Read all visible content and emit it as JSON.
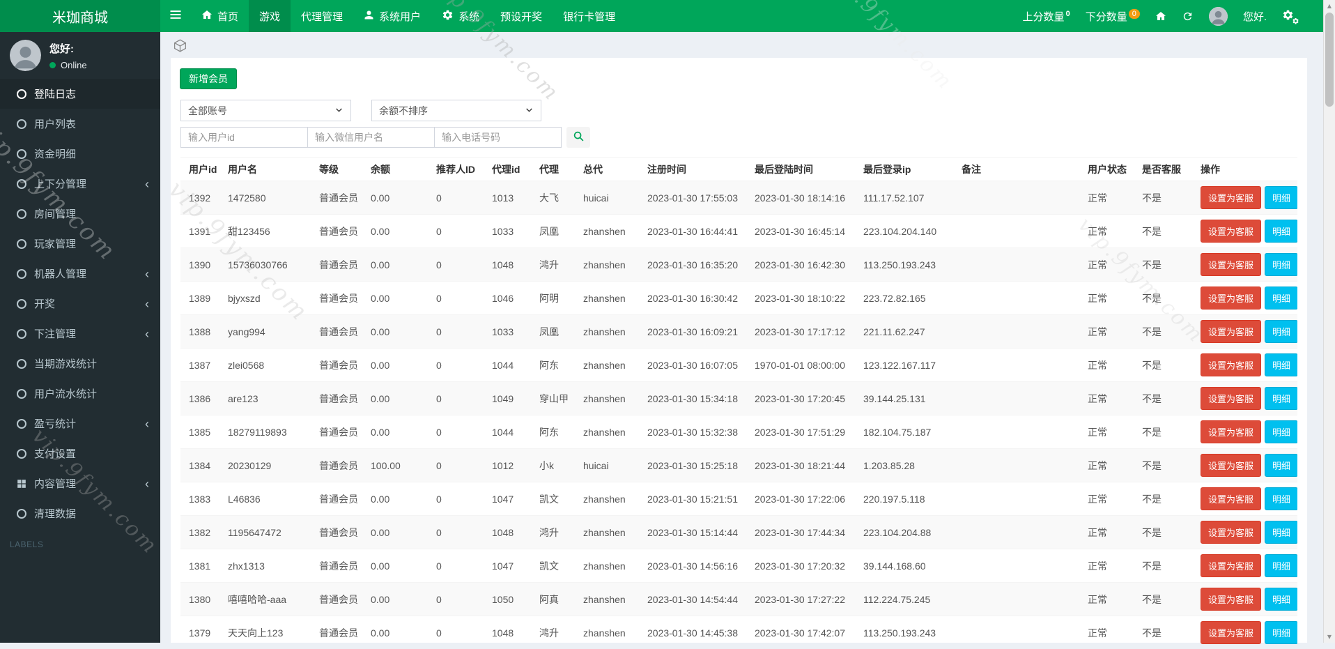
{
  "watermark": "vip.9fym.com",
  "colors": {
    "navbar_green": "#00a65a",
    "dark_green": "#008d4c",
    "sidebar_dark": "#222d32",
    "danger_red": "#dd4b39",
    "info_cyan": "#00c0ef",
    "badge_orange": "#f39c12"
  },
  "navbar": {
    "brand": "米珈商城",
    "items": [
      {
        "key": "home",
        "label": "首页",
        "icon": "home"
      },
      {
        "key": "games",
        "label": "游戏",
        "active": true
      },
      {
        "key": "agent-manage",
        "label": "代理管理"
      },
      {
        "key": "system-users",
        "label": "系统用户",
        "icon": "user"
      },
      {
        "key": "system",
        "label": "系统",
        "icon": "gear"
      },
      {
        "key": "preset-lottery",
        "label": "预设开奖"
      },
      {
        "key": "bank-card-manage",
        "label": "银行卡管理"
      }
    ],
    "right": {
      "up_label": "上分数量",
      "up_badge": "0",
      "down_label": "下分数量",
      "down_badge": "0",
      "greeting": "您好."
    }
  },
  "sidebar": {
    "greeting": "您好:",
    "online": "Online",
    "labels_header": "LABELS",
    "items": [
      {
        "key": "login-log",
        "label": "登陆日志",
        "icon": "circle",
        "active": true
      },
      {
        "key": "user-list",
        "label": "用户列表",
        "icon": "circle"
      },
      {
        "key": "funds-detail",
        "label": "资金明细",
        "icon": "circle"
      },
      {
        "key": "score-manage",
        "label": "上下分管理",
        "icon": "circle",
        "chevron": true
      },
      {
        "key": "room-manage",
        "label": "房间管理",
        "icon": "circle"
      },
      {
        "key": "player-manage",
        "label": "玩家管理",
        "icon": "circle"
      },
      {
        "key": "robot-manage",
        "label": "机器人管理",
        "icon": "circle",
        "chevron": true
      },
      {
        "key": "lottery",
        "label": "开奖",
        "icon": "circle",
        "chevron": true
      },
      {
        "key": "bet-manage",
        "label": "下注管理",
        "icon": "circle",
        "chevron": true
      },
      {
        "key": "current-game-stats",
        "label": "当期游戏统计",
        "icon": "circle"
      },
      {
        "key": "user-flow-stats",
        "label": "用户流水统计",
        "icon": "circle"
      },
      {
        "key": "profit-stats",
        "label": "盈亏统计",
        "icon": "circle",
        "chevron": true
      },
      {
        "key": "payment-settings",
        "label": "支付设置",
        "icon": "circle"
      },
      {
        "key": "content-manage",
        "label": "内容管理",
        "icon": "grid",
        "chevron": true
      },
      {
        "key": "clean-data",
        "label": "清理数据",
        "icon": "circle"
      }
    ]
  },
  "toolbar": {
    "add_member": "新增会员",
    "select_account": "全部账号",
    "select_balance": "余额不排序",
    "ph_user_id": "输入用户id",
    "ph_wechat": "输入微信用户名",
    "ph_phone": "输入电话号码"
  },
  "table": {
    "headers": [
      "用户id",
      "用户名",
      "等级",
      "余额",
      "推荐人ID",
      "代理id",
      "代理",
      "总代",
      "注册时间",
      "最后登陆时间",
      "最后登录ip",
      "备注",
      "用户状态",
      "是否客服",
      "操作"
    ],
    "status_normal": "正常",
    "service_no": "不是",
    "btn_service": "设置为客服",
    "btn_detail": "明细",
    "rows": [
      [
        "1392",
        "1472580",
        "普通会员",
        "0.00",
        "0",
        "1013",
        "大飞",
        "huicai",
        "2023-01-30 17:55:03",
        "2023-01-30 18:14:16",
        "111.17.52.107"
      ],
      [
        "1391",
        "甜123456",
        "普通会员",
        "0.00",
        "0",
        "1033",
        "凤凰",
        "zhanshen",
        "2023-01-30 16:44:41",
        "2023-01-30 16:45:14",
        "223.104.204.140"
      ],
      [
        "1390",
        "15736030766",
        "普通会员",
        "0.00",
        "0",
        "1048",
        "鸿升",
        "zhanshen",
        "2023-01-30 16:35:20",
        "2023-01-30 16:42:30",
        "113.250.193.243"
      ],
      [
        "1389",
        "bjyxszd",
        "普通会员",
        "0.00",
        "0",
        "1046",
        "阿明",
        "zhanshen",
        "2023-01-30 16:30:42",
        "2023-01-30 18:10:22",
        "223.72.82.165"
      ],
      [
        "1388",
        "yang994",
        "普通会员",
        "0.00",
        "0",
        "1033",
        "凤凰",
        "zhanshen",
        "2023-01-30 16:09:21",
        "2023-01-30 17:17:12",
        "221.11.62.247"
      ],
      [
        "1387",
        "zlei0568",
        "普通会员",
        "0.00",
        "0",
        "1044",
        "阿东",
        "zhanshen",
        "2023-01-30 16:07:05",
        "1970-01-01 08:00:00",
        "123.122.167.117"
      ],
      [
        "1386",
        "are123",
        "普通会员",
        "0.00",
        "0",
        "1049",
        "穿山甲",
        "zhanshen",
        "2023-01-30 15:34:18",
        "2023-01-30 17:20:45",
        "39.144.25.131"
      ],
      [
        "1385",
        "18279119893",
        "普通会员",
        "0.00",
        "0",
        "1044",
        "阿东",
        "zhanshen",
        "2023-01-30 15:32:38",
        "2023-01-30 17:51:29",
        "182.104.75.187"
      ],
      [
        "1384",
        "20230129",
        "普通会员",
        "100.00",
        "0",
        "1012",
        "小k",
        "huicai",
        "2023-01-30 15:25:18",
        "2023-01-30 18:21:44",
        "1.203.85.28"
      ],
      [
        "1383",
        "L46836",
        "普通会员",
        "0.00",
        "0",
        "1047",
        "凯文",
        "zhanshen",
        "2023-01-30 15:21:51",
        "2023-01-30 17:22:06",
        "220.197.5.118"
      ],
      [
        "1382",
        "1195647472",
        "普通会员",
        "0.00",
        "0",
        "1048",
        "鸿升",
        "zhanshen",
        "2023-01-30 15:14:44",
        "2023-01-30 17:44:34",
        "223.104.204.88"
      ],
      [
        "1381",
        "zhx1313",
        "普通会员",
        "0.00",
        "0",
        "1047",
        "凯文",
        "zhanshen",
        "2023-01-30 14:56:16",
        "2023-01-30 17:20:32",
        "39.144.168.60"
      ],
      [
        "1380",
        "嘻嘻哈哈-aaa",
        "普通会员",
        "0.00",
        "0",
        "1050",
        "阿真",
        "zhanshen",
        "2023-01-30 14:54:44",
        "2023-01-30 17:27:22",
        "112.224.75.245"
      ],
      [
        "1379",
        "天天向上123",
        "普通会员",
        "0.00",
        "0",
        "1048",
        "鸿升",
        "zhanshen",
        "2023-01-30 14:45:38",
        "2023-01-30 17:42:07",
        "113.250.193.243"
      ]
    ]
  }
}
